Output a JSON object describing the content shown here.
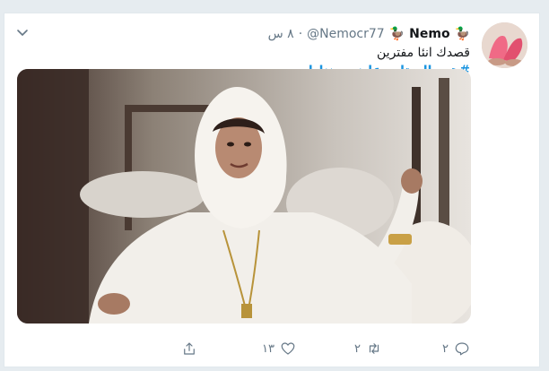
{
  "tweet": {
    "author": {
      "name": "Nemo",
      "handle": "@Nemocr77",
      "emoji_left": "🦆",
      "emoji_right": "🦆"
    },
    "separator": "·",
    "timestamp": "٨ س",
    "text": "قصدك انئا مفترين",
    "hashtag": "#هي_الستات_عايزه_مننا_ايه",
    "menu_icon": "chevron-down-icon",
    "actions": {
      "replies": "٢",
      "retweets": "٢",
      "likes": "١٣"
    }
  },
  "colors": {
    "hashtag": "#1b95e0",
    "secondary_text": "#657786",
    "border": "#e1e8ed"
  }
}
